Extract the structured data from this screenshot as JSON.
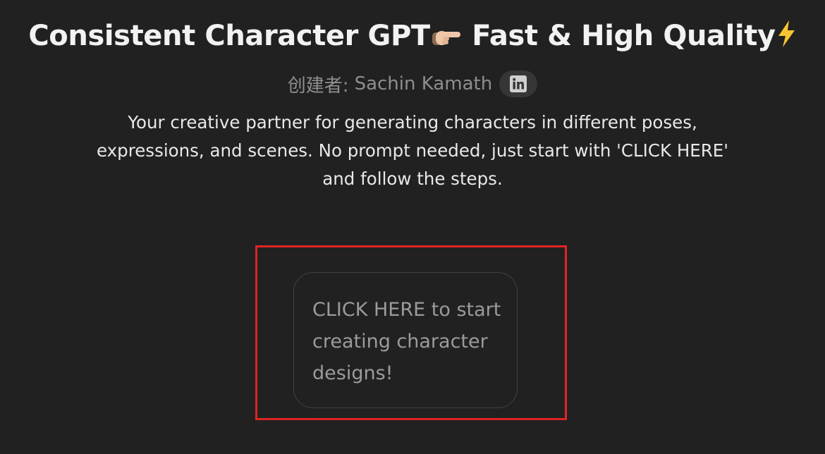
{
  "header": {
    "title_part1": "Consistent Character GPT",
    "title_part2": " Fast & High Quality",
    "pointing_emoji_icon": "backhand-index-pointing-right-icon",
    "lightning_emoji_icon": "high-voltage-icon"
  },
  "creator": {
    "prefix": "创建者:",
    "name": "Sachin Kamath",
    "social_icon": "linkedin-icon"
  },
  "description": "Your creative partner for generating characters in different poses, expressions, and scenes. No prompt needed, just start with 'CLICK HERE' and follow the steps.",
  "starters": [
    {
      "text": "CLICK HERE to start creating character designs!"
    }
  ],
  "colors": {
    "background": "#212121",
    "highlight": "#e02424",
    "muted_text": "#8e8e8e"
  }
}
